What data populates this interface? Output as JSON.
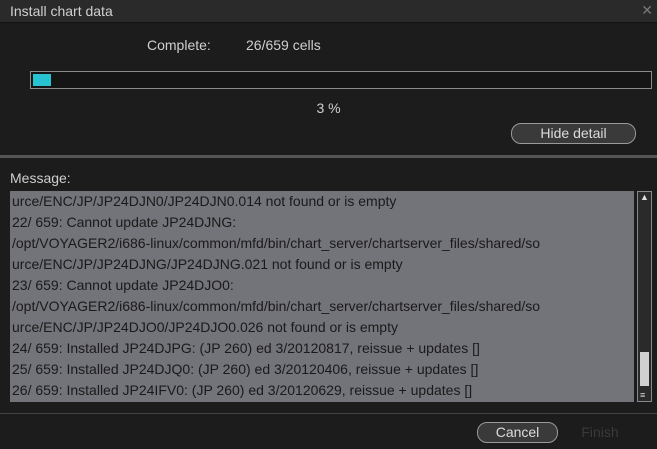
{
  "window": {
    "title": "Install chart data"
  },
  "status": {
    "complete_label": "Complete:",
    "complete_value": "26/659 cells",
    "progress_fraction": 0.03,
    "percent_text": "3 %"
  },
  "buttons": {
    "hide_detail": "Hide detail",
    "cancel": "Cancel",
    "finish": "Finish"
  },
  "message": {
    "label": "Message:",
    "lines": [
      "urce/ENC/JP/JP24DJN0/JP24DJN0.014 not found or is empty",
      "  22/ 659: Cannot update JP24DJNG:",
      "/opt/VOYAGER2/i686-linux/common/mfd/bin/chart_server/chartserver_files/shared/so",
      "urce/ENC/JP/JP24DJNG/JP24DJNG.021 not found or is empty",
      "  23/ 659: Cannot update JP24DJO0:",
      "/opt/VOYAGER2/i686-linux/common/mfd/bin/chart_server/chartserver_files/shared/so",
      "urce/ENC/JP/JP24DJO0/JP24DJO0.026 not found or is empty",
      "  24/ 659: Installed JP24DJPG: (JP 260) ed  3/20120817, reissue + updates []",
      "  25/ 659: Installed JP24DJQ0: (JP 260) ed  3/20120406, reissue + updates []",
      "  26/ 659: Installed JP24IFV0: (JP 260) ed  3/20120629, reissue + updates []"
    ]
  },
  "colors": {
    "progress_fill": "#27c3d2",
    "message_background": "#73737a"
  },
  "icons": {
    "close": "close-icon",
    "scroll_up": "scroll-up-arrow-icon",
    "scroll_down": "scroll-down-arrow-icon"
  }
}
